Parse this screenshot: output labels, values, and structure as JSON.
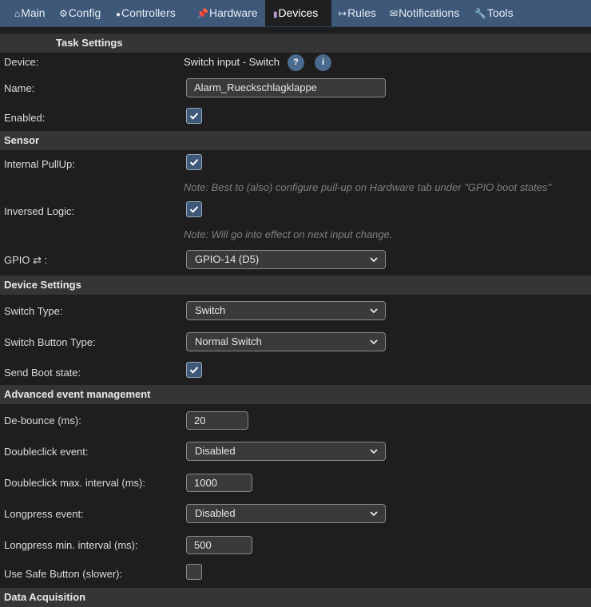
{
  "nav": {
    "tabs": [
      {
        "label": "Main",
        "icon": "⌂"
      },
      {
        "label": "Config",
        "icon": "⚙"
      },
      {
        "label": "Controllers",
        "icon": "💬"
      },
      {
        "label": "Hardware",
        "icon": "📌"
      },
      {
        "label": "Devices",
        "icon": "🔌"
      },
      {
        "label": "Rules",
        "icon": "↦"
      },
      {
        "label": "Notifications",
        "icon": "✉"
      },
      {
        "label": "Tools",
        "icon": "🔧"
      }
    ]
  },
  "task_settings": {
    "heading": "Task Settings",
    "device_label": "Device:",
    "device_value": "Switch input - Switch",
    "help_glyph": "?",
    "info_glyph": "i",
    "name_label": "Name:",
    "name_value": "Alarm_Rueckschlagklappe",
    "enabled_label": "Enabled:",
    "enabled": true
  },
  "sensor": {
    "heading": "Sensor",
    "pullup_label": "Internal PullUp:",
    "pullup": true,
    "pullup_note": "Note: Best to (also) configure pull-up on Hardware tab under \"GPIO boot states\"",
    "inversed_label": "Inversed Logic:",
    "inversed": true,
    "inversed_note": "Note: Will go into effect on next input change.",
    "gpio_label": "GPIO ⇄ :",
    "gpio_value": "GPIO-14 (D5)"
  },
  "device_settings": {
    "heading": "Device Settings",
    "switch_type_label": "Switch Type:",
    "switch_type_value": "Switch",
    "button_type_label": "Switch Button Type:",
    "button_type_value": "Normal Switch",
    "boot_state_label": "Send Boot state:",
    "boot_state": true
  },
  "advanced": {
    "heading": "Advanced event management",
    "debounce_label": "De-bounce (ms):",
    "debounce_value": "20",
    "doubleclick_label": "Doubleclick event:",
    "doubleclick_value": "Disabled",
    "dc_interval_label": "Doubleclick max. interval (ms):",
    "dc_interval_value": "1000",
    "longpress_label": "Longpress event:",
    "longpress_value": "Disabled",
    "lp_interval_label": "Longpress min. interval (ms):",
    "lp_interval_value": "500",
    "safe_button_label": "Use Safe Button (slower):",
    "safe_button": false
  },
  "next_section": {
    "heading": "Data Acquisition"
  },
  "colors": {
    "nav_bg": "#3d5878",
    "page_bg": "#1e1e1e",
    "section_bg": "#353535",
    "accent": "#3d5878",
    "help_bg": "#4a6a8e"
  }
}
